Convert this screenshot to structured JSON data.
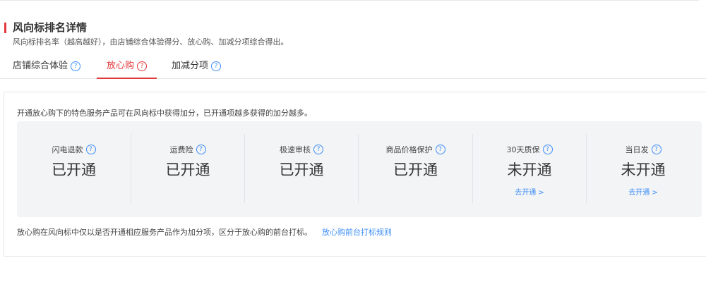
{
  "header": {
    "title": "风向标排名详情",
    "subtitle": "风向标排名率（越高越好），由店铺综合体验得分、放心购、加减分项综合得出。"
  },
  "tabs": [
    {
      "label": "店铺综合体验",
      "active": false
    },
    {
      "label": "放心购",
      "active": true
    },
    {
      "label": "加减分项",
      "active": false
    }
  ],
  "panel": {
    "description": "开通放心购下的特色服务产品可在风向标中获得加分，已开通项越多获得的加分越多。",
    "services": [
      {
        "name": "闪电退款",
        "status": "已开通",
        "link": ""
      },
      {
        "name": "运费险",
        "status": "已开通",
        "link": ""
      },
      {
        "name": "极速审核",
        "status": "已开通",
        "link": ""
      },
      {
        "name": "商品价格保护",
        "status": "已开通",
        "link": ""
      },
      {
        "name": "30天质保",
        "status": "未开通",
        "link": "去开通 >"
      },
      {
        "name": "当日发",
        "status": "未开通",
        "link": "去开通 >"
      }
    ],
    "footer_note": "放心购在风向标中仅以是否开通相应服务产品作为加分项，区分于放心购的前台打标。",
    "footer_link": "放心购前台打标规则"
  },
  "icons": {
    "help": "question-circle-icon"
  },
  "colors": {
    "accent_red": "#e4393c",
    "link_blue": "#3e8ef7",
    "panel_bg": "#f3f4f6"
  }
}
